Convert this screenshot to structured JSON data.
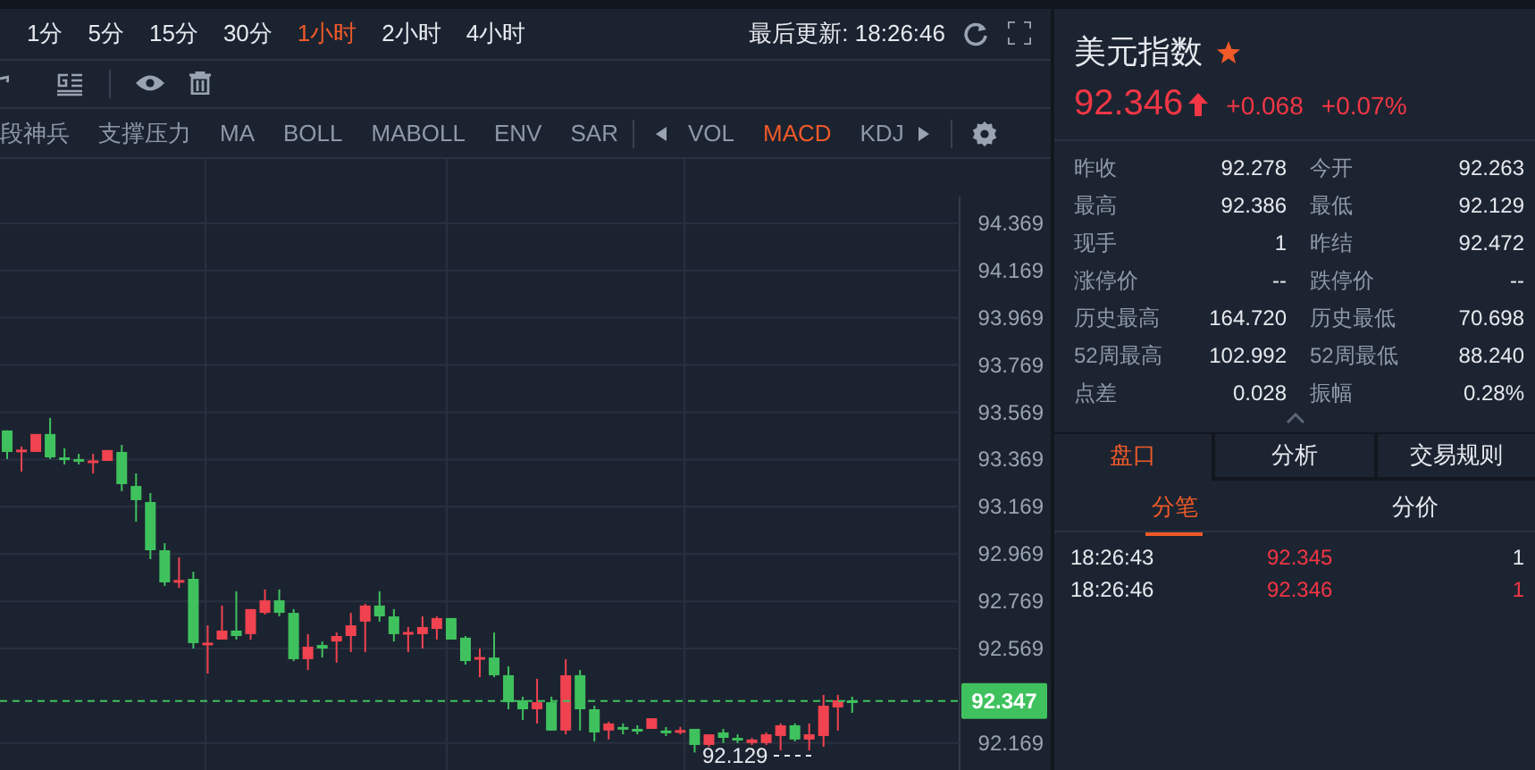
{
  "toolbar": {
    "intervals": [
      {
        "label": "1分",
        "selected": false
      },
      {
        "label": "5分",
        "selected": false
      },
      {
        "label": "15分",
        "selected": false
      },
      {
        "label": "30分",
        "selected": false
      },
      {
        "label": "1小时",
        "selected": true
      },
      {
        "label": "2小时",
        "selected": false
      },
      {
        "label": "4小时",
        "selected": false
      }
    ],
    "last_update": "最后更新: 18:26:46"
  },
  "indicators": [
    {
      "label": "段神兵",
      "selected": false
    },
    {
      "label": "支撑压力",
      "selected": false
    },
    {
      "label": "MA",
      "selected": false
    },
    {
      "label": "BOLL",
      "selected": false
    },
    {
      "label": "MABOLL",
      "selected": false
    },
    {
      "label": "ENV",
      "selected": false
    },
    {
      "label": "SAR",
      "selected": false
    }
  ],
  "sub_indicators": [
    {
      "label": "VOL",
      "selected": false
    },
    {
      "label": "MACD",
      "selected": true
    },
    {
      "label": "KDJ",
      "selected": false
    }
  ],
  "chart": {
    "chart_data": {
      "type": "candlestick",
      "ohlc": [
        [
          93.492,
          93.492,
          93.371,
          93.401
        ],
        [
          93.409,
          93.424,
          93.318,
          93.411
        ],
        [
          93.401,
          93.477,
          93.401,
          93.477
        ],
        [
          93.477,
          93.545,
          93.371,
          93.378
        ],
        [
          93.378,
          93.416,
          93.348,
          93.376
        ],
        [
          93.371,
          93.393,
          93.348,
          93.369
        ],
        [
          93.363,
          93.393,
          93.31,
          93.365
        ],
        [
          93.363,
          93.409,
          93.363,
          93.409
        ],
        [
          93.401,
          93.431,
          93.235,
          93.265
        ],
        [
          93.257,
          93.31,
          93.106,
          93.197
        ],
        [
          93.189,
          93.227,
          92.947,
          92.985
        ],
        [
          92.985,
          93.015,
          92.834,
          92.849
        ],
        [
          92.857,
          92.955,
          92.826,
          92.859
        ],
        [
          92.864,
          92.894,
          92.569,
          92.592
        ],
        [
          92.592,
          92.667,
          92.463,
          92.594
        ],
        [
          92.607,
          92.751,
          92.607,
          92.645
        ],
        [
          92.645,
          92.811,
          92.607,
          92.622
        ],
        [
          92.63,
          92.736,
          92.607,
          92.736
        ],
        [
          92.72,
          92.819,
          92.713,
          92.773
        ],
        [
          92.773,
          92.819,
          92.705,
          92.72
        ],
        [
          92.72,
          92.736,
          92.516,
          92.524
        ],
        [
          92.524,
          92.63,
          92.478,
          92.577
        ],
        [
          92.584,
          92.599,
          92.531,
          92.569
        ],
        [
          92.599,
          92.637,
          92.509,
          92.622
        ],
        [
          92.622,
          92.72,
          92.554,
          92.667
        ],
        [
          92.683,
          92.758,
          92.554,
          92.751
        ],
        [
          92.751,
          92.811,
          92.683,
          92.705
        ],
        [
          92.705,
          92.736,
          92.599,
          92.63
        ],
        [
          92.637,
          92.66,
          92.554,
          92.639
        ],
        [
          92.63,
          92.705,
          92.569,
          92.66
        ],
        [
          92.652,
          92.705,
          92.607,
          92.698
        ],
        [
          92.698,
          92.698,
          92.607,
          92.607
        ],
        [
          92.615,
          92.622,
          92.501,
          92.516
        ],
        [
          92.531,
          92.569,
          92.448,
          92.533
        ],
        [
          92.531,
          92.637,
          92.448,
          92.456
        ],
        [
          92.456,
          92.494,
          92.312,
          92.342
        ],
        [
          92.35,
          92.365,
          92.267,
          92.312
        ],
        [
          92.312,
          92.441,
          92.252,
          92.342
        ],
        [
          92.342,
          92.365,
          92.222,
          92.222
        ],
        [
          92.222,
          92.524,
          92.206,
          92.456
        ],
        [
          92.456,
          92.478,
          92.222,
          92.312
        ],
        [
          92.312,
          92.327,
          92.176,
          92.214
        ],
        [
          92.222,
          92.259,
          92.184,
          92.252
        ],
        [
          92.237,
          92.252,
          92.206,
          92.235
        ],
        [
          92.229,
          92.244,
          92.206,
          92.227
        ],
        [
          92.229,
          92.274,
          92.229,
          92.274
        ],
        [
          92.222,
          92.237,
          92.199,
          92.22
        ],
        [
          92.222,
          92.237,
          92.206,
          92.224
        ],
        [
          92.229,
          92.229,
          92.129,
          92.161
        ],
        [
          92.161,
          92.206,
          92.153,
          92.206
        ],
        [
          92.214,
          92.229,
          92.169,
          92.191
        ],
        [
          92.191,
          92.206,
          92.169,
          92.189
        ],
        [
          92.169,
          92.191,
          92.161,
          92.184
        ],
        [
          92.169,
          92.214,
          92.161,
          92.206
        ],
        [
          92.199,
          92.252,
          92.138,
          92.244
        ],
        [
          92.244,
          92.252,
          92.176,
          92.184
        ],
        [
          92.184,
          92.252,
          92.138,
          92.206
        ],
        [
          92.199,
          92.373,
          92.153,
          92.327
        ],
        [
          92.32,
          92.373,
          92.222,
          92.35
        ],
        [
          92.35,
          92.365,
          92.297,
          92.347
        ],
        null,
        null,
        null,
        null,
        null,
        null,
        null
      ],
      "grid": true,
      "ylim": [
        92.055,
        94.482
      ],
      "yticks": [
        94.369,
        94.169,
        93.969,
        93.769,
        93.569,
        93.369,
        93.169,
        92.969,
        92.769,
        92.569,
        92.169
      ],
      "ref_lines": [
        {
          "axis": "y",
          "value": 92.347,
          "label": "92.347"
        }
      ]
    },
    "low_label": "92.129"
  },
  "quote": {
    "title": "美元指数",
    "favorite": true,
    "price": "92.346",
    "change": "+0.068",
    "change_pct": "+0.07%",
    "stats": [
      [
        "昨收",
        "92.278",
        "今开",
        "92.263"
      ],
      [
        "最高",
        "92.386",
        "最低",
        "92.129"
      ],
      [
        "现手",
        "1",
        "昨结",
        "92.472"
      ],
      [
        "涨停价",
        "--",
        "跌停价",
        "--"
      ],
      [
        "历史最高",
        "164.720",
        "历史最低",
        "70.698"
      ],
      [
        "52周最高",
        "102.992",
        "52周最低",
        "88.240"
      ],
      [
        "点差",
        "0.028",
        "振幅",
        "0.28%"
      ]
    ]
  },
  "panel_tabs": [
    {
      "label": "盘口",
      "selected": true
    },
    {
      "label": "分析",
      "selected": false
    },
    {
      "label": "交易规则",
      "selected": false
    }
  ],
  "sub_tabs": [
    {
      "label": "分笔",
      "selected": true
    },
    {
      "label": "分价",
      "selected": false
    }
  ],
  "trades": [
    {
      "time": "18:26:43",
      "price": "92.345",
      "volume": "1",
      "highlight": false
    },
    {
      "time": "18:26:46",
      "price": "92.346",
      "volume": "1",
      "highlight": true
    }
  ]
}
